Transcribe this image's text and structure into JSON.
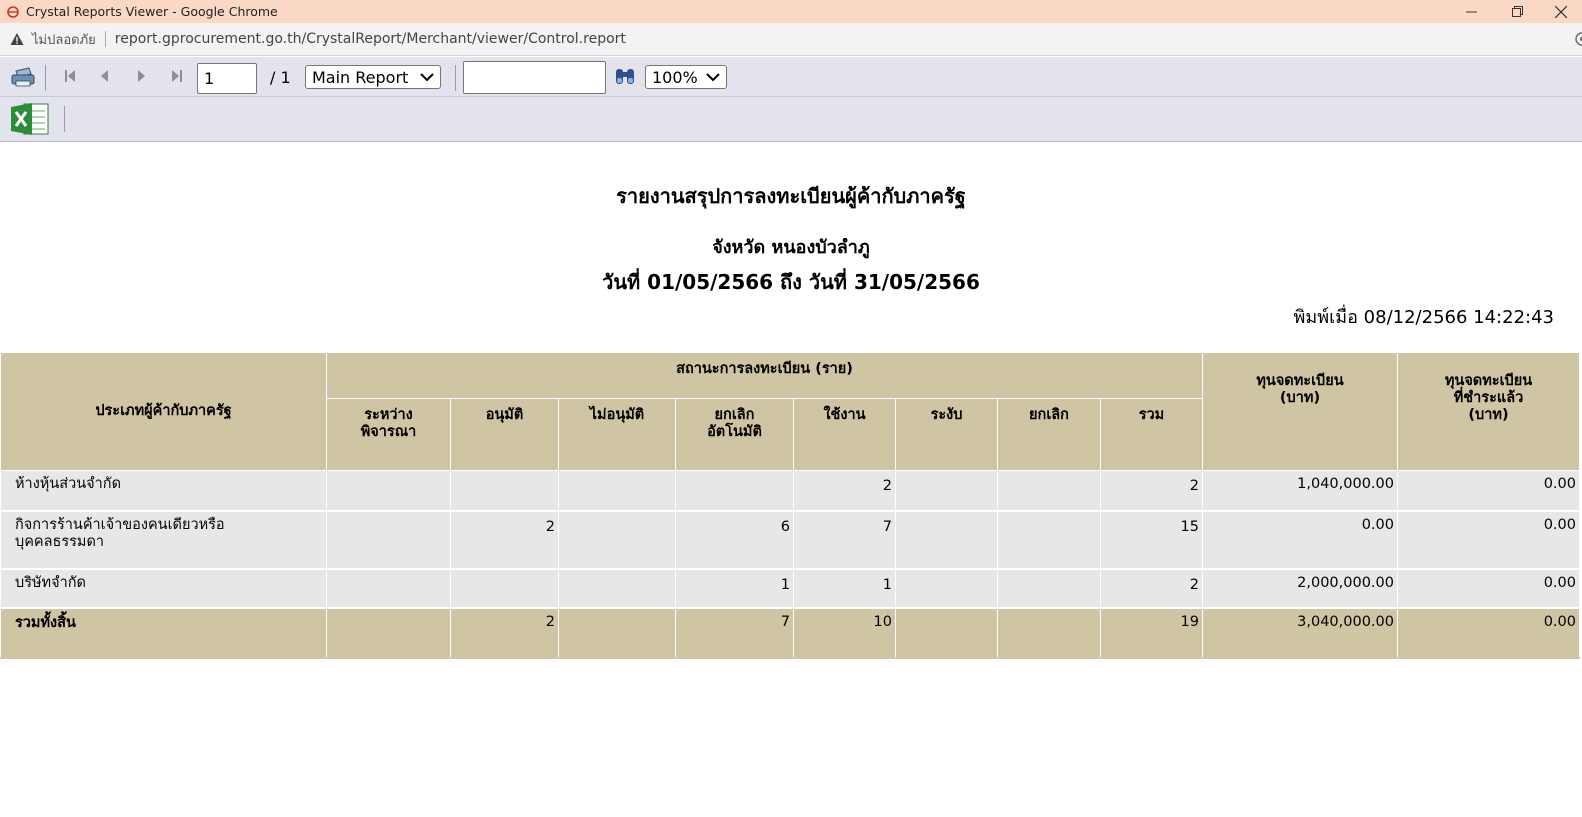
{
  "window": {
    "title": "Crystal Reports Viewer - Google Chrome"
  },
  "address_bar": {
    "security_label": "ไม่ปลอดภัย",
    "url": "report.gprocurement.go.th/CrystalReport/Merchant/viewer/Control.report"
  },
  "toolbar": {
    "page_value": "1",
    "page_total": "/ 1",
    "report_select": "Main Report",
    "search_value": "",
    "zoom": "100%"
  },
  "report": {
    "title": "รายงานสรุปการลงทะเบียนผู้ค้ากับภาครัฐ",
    "province": "จังหวัด หนองบัวลำภู",
    "date_range": "วันที่ 01/05/2566 ถึง วันที่ 31/05/2566",
    "printed_at": "พิมพ์เมื่อ 08/12/2566  14:22:43",
    "headers": {
      "type": "ประเภทผู้ค้ากับภาครัฐ",
      "status_group": "สถานะการลงทะเบียน (ราย)",
      "pending": [
        "ระหว่าง",
        "พิจารณา"
      ],
      "approved": "อนุมัติ",
      "not_approved": "ไม่อนุมัติ",
      "cancel_auto": [
        "ยกเลิก",
        "อัตโนมัติ"
      ],
      "active": "ใช้งาน",
      "suspended": "ระงับ",
      "cancelled": "ยกเลิก",
      "total": "รวม",
      "capital": [
        "ทุนจดทะเบียน",
        "(บาท)"
      ],
      "paid_capital": [
        "ทุนจดทะเบียน",
        "ที่ชำระแล้ว",
        "(บาท)"
      ]
    },
    "rows": [
      {
        "label": [
          "ห้างหุ้นส่วนจำกัด"
        ],
        "pending": "",
        "approved": "",
        "not_approved": "",
        "cancel_auto": "",
        "active": "2",
        "suspended": "",
        "cancelled": "",
        "total": "2",
        "capital": "1,040,000.00",
        "paid_capital": "0.00"
      },
      {
        "label": [
          "กิจการร้านค้าเจ้าของคนเดียวหรือ",
          "บุคคลธรรมดา"
        ],
        "pending": "",
        "approved": "2",
        "not_approved": "",
        "cancel_auto": "6",
        "active": "7",
        "suspended": "",
        "cancelled": "",
        "total": "15",
        "capital": "0.00",
        "paid_capital": "0.00"
      },
      {
        "label": [
          "บริษัทจำกัด"
        ],
        "pending": "",
        "approved": "",
        "not_approved": "",
        "cancel_auto": "1",
        "active": "1",
        "suspended": "",
        "cancelled": "",
        "total": "2",
        "capital": "2,000,000.00",
        "paid_capital": "0.00"
      }
    ],
    "totals": {
      "label": "รวมทั้งสิ้น",
      "pending": "",
      "approved": "2",
      "not_approved": "",
      "cancel_auto": "7",
      "active": "10",
      "suspended": "",
      "cancelled": "",
      "total": "19",
      "capital": "3,040,000.00",
      "paid_capital": "0.00"
    }
  }
}
